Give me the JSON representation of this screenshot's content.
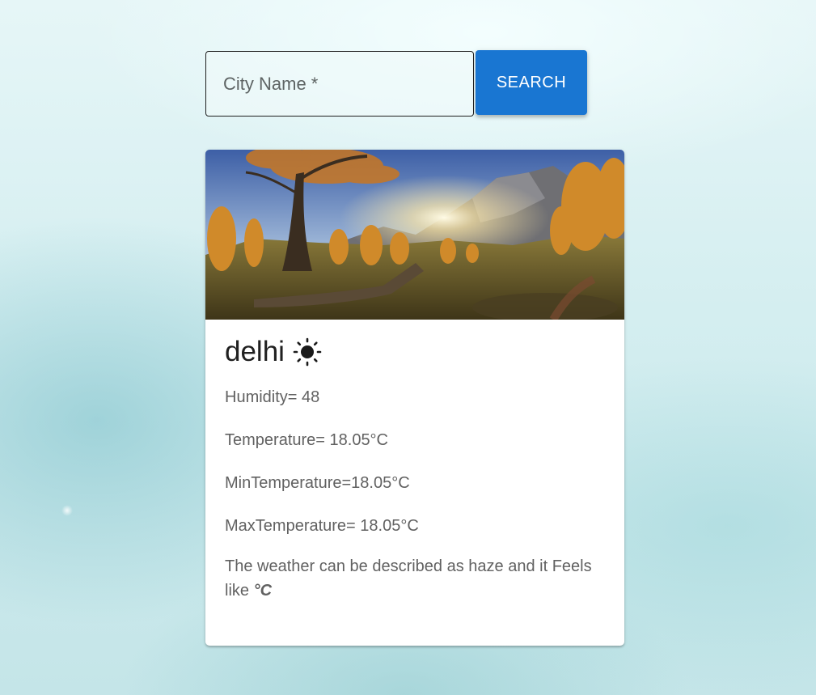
{
  "search": {
    "placeholder": "City Name *",
    "button_label": "SEARCH"
  },
  "card": {
    "image_alt": "mountain-autumn-landscape",
    "city": "delhi",
    "weather_icon": "sun-icon",
    "humidity_label": "Humidity= 48",
    "temperature_label": "Temperature= 18.05°C",
    "min_temperature_label": "MinTemperature=18.05°C",
    "max_temperature_label": "MaxTemperature= 18.05°C",
    "description_text": "The weather can be described as haze and it Feels like",
    "feels_like_unit": "°C"
  },
  "colors": {
    "button": "#1976d2",
    "text_secondary": "#616161",
    "text_primary": "#202020"
  }
}
